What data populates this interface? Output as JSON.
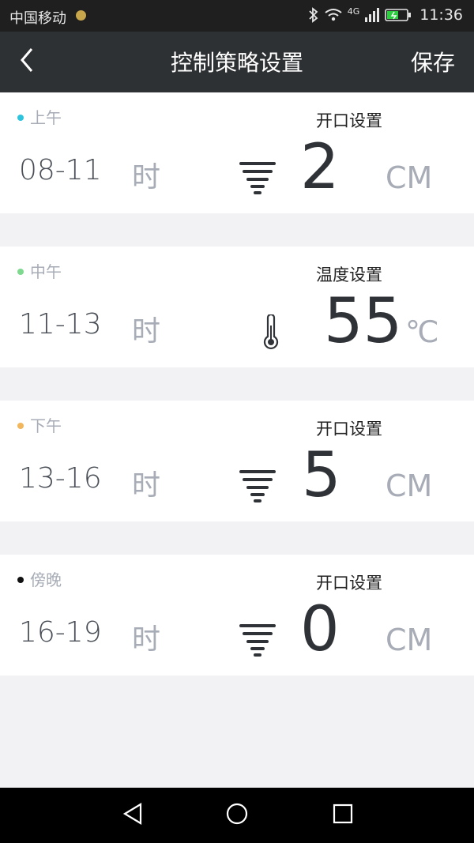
{
  "status_bar": {
    "carrier": "中国移动",
    "network": "4G",
    "time": "11:36"
  },
  "header": {
    "title": "控制策略设置",
    "save_label": "保存"
  },
  "periods": [
    {
      "name": "上午",
      "dot_color": "#2fc4dd",
      "range": "08-11",
      "hour_unit": "时",
      "setting_label": "开口设置",
      "icon": "vent-opening-icon",
      "value": "2",
      "unit": "CM"
    },
    {
      "name": "中午",
      "dot_color": "#7ed88e",
      "range": "11-13",
      "hour_unit": "时",
      "setting_label": "温度设置",
      "icon": "thermometer-icon",
      "value": "55",
      "unit": "℃"
    },
    {
      "name": "下午",
      "dot_color": "#f2b65c",
      "range": "13-16",
      "hour_unit": "时",
      "setting_label": "开口设置",
      "icon": "vent-opening-icon",
      "value": "5",
      "unit": "CM"
    },
    {
      "name": "傍晚",
      "dot_color": "#111111",
      "range": "16-19",
      "hour_unit": "时",
      "setting_label": "开口设置",
      "icon": "vent-opening-icon",
      "value": "0",
      "unit": "CM"
    }
  ]
}
